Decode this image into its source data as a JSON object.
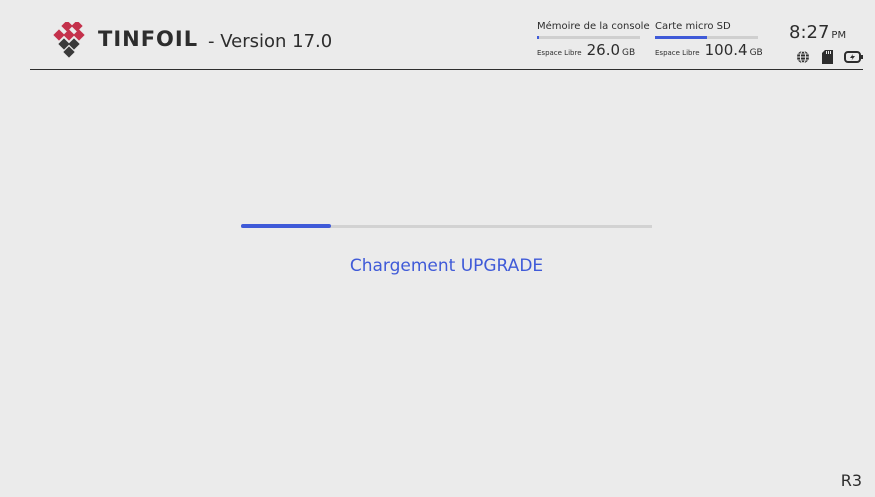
{
  "header": {
    "app_name": "TINFOIL",
    "version": "- Version 17.0",
    "brand_color": "#c4314b"
  },
  "storage": {
    "console": {
      "label": "Mémoire de la console",
      "free_label": "Espace Libre",
      "free_value": "26.0",
      "unit": "GB",
      "used_fraction": 0.02
    },
    "sd": {
      "label": "Carte micro SD",
      "free_label": "Espace Libre",
      "free_value": "100.4",
      "unit": "GB",
      "used_fraction": 0.5
    }
  },
  "clock": {
    "time": "8:27",
    "ampm": "PM"
  },
  "status_icons": [
    "globe-icon",
    "sd-card-icon",
    "battery-icon"
  ],
  "loading": {
    "text": "Chargement UPGRADE",
    "progress_fraction": 0.22
  },
  "footer": {
    "button_hint": "R3"
  },
  "colors": {
    "background": "#ebebeb",
    "accent": "#3f5ad8",
    "text": "#2d2d2d"
  }
}
